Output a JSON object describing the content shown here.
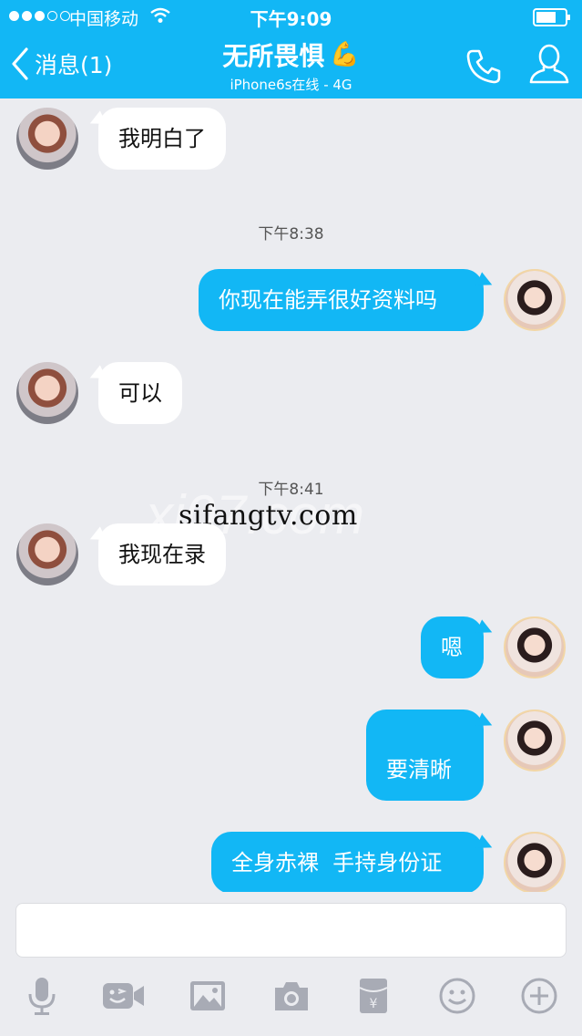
{
  "status_bar": {
    "carrier": "中国移动",
    "time": "下午9:09"
  },
  "nav": {
    "back_label": "消息(1)",
    "title": "无所畏惧",
    "title_emoji": "💪",
    "subtitle": "iPhone6s在线 - 4G"
  },
  "messages": [
    {
      "from": "friend",
      "text": "我明白了"
    },
    {
      "timestamp": "下午8:38"
    },
    {
      "from": "self",
      "text": "你现在能弄很好资料吗"
    },
    {
      "from": "friend",
      "text": "可以"
    },
    {
      "timestamp": "下午8:41"
    },
    {
      "from": "friend",
      "text": "我现在录"
    },
    {
      "from": "self",
      "text": "嗯"
    },
    {
      "from": "self",
      "text": "要清晰"
    },
    {
      "from": "self",
      "text": "全身赤裸  手持身份证"
    }
  ],
  "watermark": "sifangtv.com",
  "watermark_faint": "xi07.com",
  "input": {
    "value": ""
  },
  "toolbar_icons": [
    "microphone-icon",
    "video-chat-icon",
    "image-icon",
    "camera-icon",
    "red-packet-icon",
    "emoji-icon",
    "plus-icon"
  ],
  "colors": {
    "accent": "#12b7f5",
    "background": "#ebecf0",
    "incoming_bubble": "#ffffff",
    "outgoing_bubble": "#12b7f5"
  }
}
